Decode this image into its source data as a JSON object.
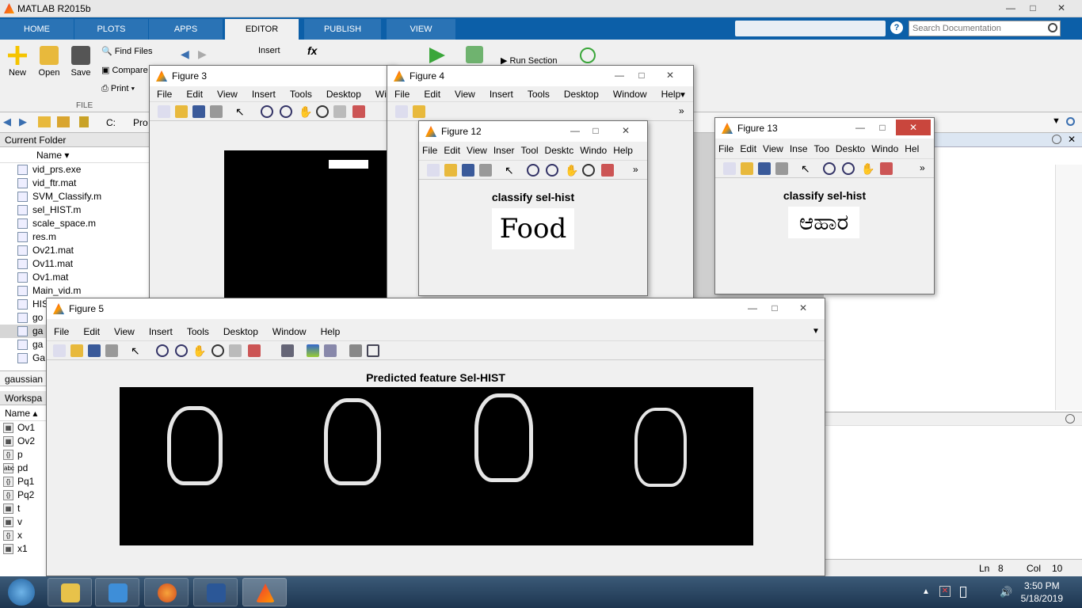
{
  "app": {
    "title": "MATLAB R2015b"
  },
  "tabs": [
    "HOME",
    "PLOTS",
    "APPS",
    "EDITOR",
    "PUBLISH",
    "VIEW"
  ],
  "active_tab": "EDITOR",
  "search": {
    "placeholder": "Search Documentation"
  },
  "ribbon": {
    "new": "New",
    "open": "Open",
    "save": "Save",
    "find_files": "Find Files",
    "compare": "Compare",
    "print": "Print",
    "insert": "Insert",
    "fx": "fx",
    "run_section": "Run Section",
    "section_file": "FILE"
  },
  "address": {
    "c": "C:",
    "pro": "Pro"
  },
  "current_folder": {
    "header": "Current Folder",
    "col_name": "Name",
    "files": [
      "vid_prs.exe",
      "vid_ftr.mat",
      "SVM_Classify.m",
      "sel_HIST.m",
      "scale_space.m",
      "res.m",
      "Ov21.mat",
      "Ov11.mat",
      "Ov1.mat",
      "Main_vid.m",
      "HIS",
      "go",
      "ga",
      "ga",
      "Ga"
    ],
    "details": "gaussian"
  },
  "workspace": {
    "header": "Workspa",
    "col_name": "Name",
    "vars": [
      {
        "icon": "matrix",
        "name": "Ov1"
      },
      {
        "icon": "matrix",
        "name": "Ov2"
      },
      {
        "icon": "cell",
        "name": "p"
      },
      {
        "icon": "char",
        "name": "pd"
      },
      {
        "icon": "cell",
        "name": "Pq1"
      },
      {
        "icon": "cell",
        "name": "Pq2"
      },
      {
        "icon": "matrix",
        "name": "t"
      },
      {
        "icon": "matrix",
        "name": "v"
      },
      {
        "icon": "cell",
        "name": "x"
      },
      {
        "icon": "matrix",
        "name": "x1"
      }
    ]
  },
  "figmenu": [
    "File",
    "Edit",
    "View",
    "Insert",
    "Tools",
    "Desktop",
    "Window",
    "Help"
  ],
  "fig3": {
    "title": "Figure 3",
    "menu": [
      "File",
      "Edit",
      "View",
      "Insert",
      "Tools",
      "Desktop",
      "Win"
    ]
  },
  "fig4": {
    "title": "Figure 4",
    "menu": [
      "File",
      "Edit",
      "View",
      "Insert",
      "Tools",
      "Desktop",
      "Window",
      "Help"
    ]
  },
  "fig12": {
    "title": "Figure 12",
    "menu": [
      "File",
      "Edit",
      "View",
      "Inser",
      "Tool",
      "Desktc",
      "Windo",
      "Help"
    ],
    "plot_title": "classify sel-hist",
    "word": "Food"
  },
  "fig13": {
    "title": "Figure 13",
    "menu": [
      "File",
      "Edit",
      "View",
      "Inse",
      "Too",
      "Deskto",
      "Windo",
      "Hel"
    ],
    "plot_title": "classify sel-hist",
    "word": "ಆಹಾರ"
  },
  "fig5": {
    "title": "Figure 5",
    "menu": [
      "File",
      "Edit",
      "View",
      "Insert",
      "Tools",
      "Desktop",
      "Window",
      "Help"
    ],
    "plot_title": "Predicted feature Sel-HIST"
  },
  "editor_status": {
    "ln_label": "Ln",
    "ln": "8",
    "col_label": "Col",
    "col": "10"
  },
  "clock": {
    "time": "3:50 PM",
    "date": "5/18/2019"
  },
  "taskbar": {
    "apps": [
      "explorer",
      "media-player",
      "firefox",
      "word",
      "matlab"
    ]
  }
}
